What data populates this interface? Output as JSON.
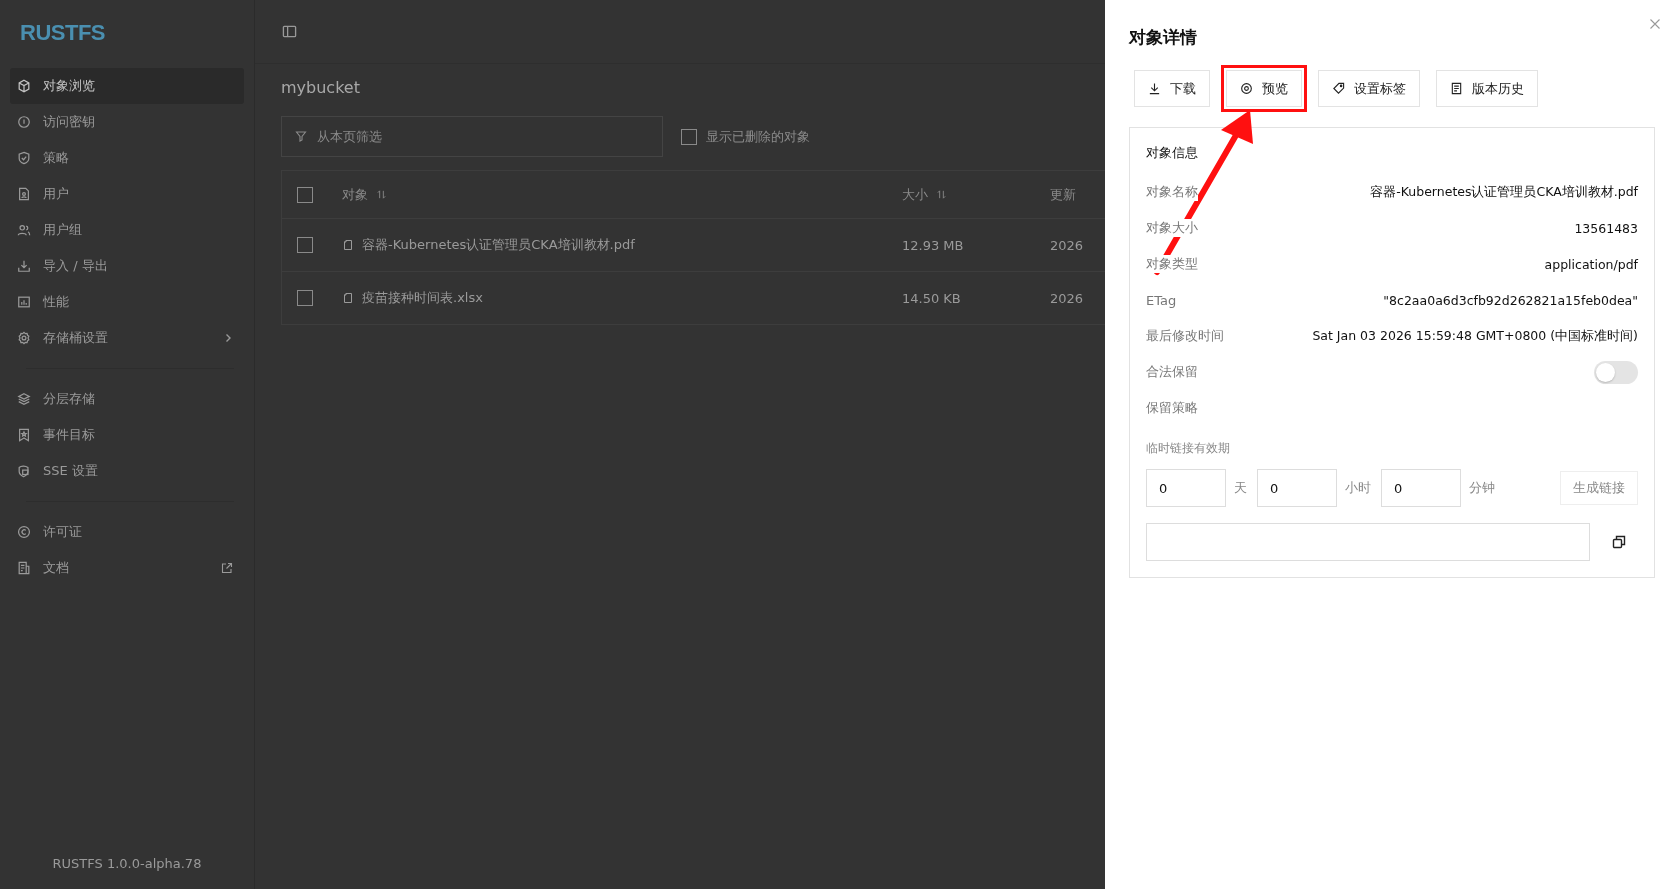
{
  "sidebar": {
    "logo": "RUSTFS",
    "groups": [
      [
        {
          "label": "对象浏览",
          "selected": true,
          "kind": "plain"
        },
        {
          "label": "访问密钥",
          "selected": false,
          "kind": "plain"
        },
        {
          "label": "策略",
          "selected": false,
          "kind": "plain"
        },
        {
          "label": "用户",
          "selected": false,
          "kind": "plain"
        },
        {
          "label": "用户组",
          "selected": false,
          "kind": "plain"
        },
        {
          "label": "导入 / 导出",
          "selected": false,
          "kind": "plain"
        },
        {
          "label": "性能",
          "selected": false,
          "kind": "plain"
        },
        {
          "label": "存储桶设置",
          "selected": false,
          "kind": "submenu"
        }
      ],
      [
        {
          "label": "分层存储",
          "selected": false,
          "kind": "plain"
        },
        {
          "label": "事件目标",
          "selected": false,
          "kind": "plain"
        },
        {
          "label": "SSE 设置",
          "selected": false,
          "kind": "plain"
        }
      ],
      [
        {
          "label": "许可证",
          "selected": false,
          "kind": "plain"
        },
        {
          "label": "文档",
          "selected": false,
          "kind": "external"
        }
      ]
    ],
    "version": "RUSTFS 1.0.0-alpha.78"
  },
  "bucket": "mybucket",
  "filter": {
    "placeholder": "从本页筛选"
  },
  "show_deleted": {
    "label": "显示已删除的对象",
    "checked": false
  },
  "table": {
    "select_all": {
      "checked": false
    },
    "columns": [
      {
        "label": "对象",
        "sortable": true
      },
      {
        "label": "大小",
        "sortable": true
      },
      {
        "label": "更新",
        "sortable": false
      }
    ],
    "rows": [
      {
        "name": "容器-Kubernetes认证管理员CKA培训教材.pdf",
        "size": "12.93 MB",
        "column_3": "2026",
        "checked": false
      },
      {
        "name": "疫苗接种时间表.xlsx",
        "size": "14.50 KB",
        "column_3": "2026",
        "checked": false
      }
    ]
  },
  "drawer": {
    "title": "对象详情",
    "actions": [
      {
        "label": "下载",
        "highlighted": false
      },
      {
        "label": "预览",
        "highlighted": true
      },
      {
        "label": "设置标签",
        "highlighted": false
      },
      {
        "label": "版本历史",
        "highlighted": false
      }
    ],
    "annotation_arrow": true,
    "info_title": "对象信息",
    "fields": [
      {
        "label": "对象名称",
        "value": "容器-Kubernetes认证管理员CKA培训教材.pdf"
      },
      {
        "label": "对象大小",
        "value": "13561483"
      },
      {
        "label": "对象类型",
        "value": "application/pdf"
      },
      {
        "label": "ETag",
        "value": "\"8c2aa0a6d3cfb92d262821a15feb0dea\""
      },
      {
        "label": "最后修改时间",
        "value": "Sat Jan 03 2026 15:59:48 GMT+0800 (中国标准时间)"
      }
    ],
    "legal_hold": {
      "label": "合法保留",
      "on": false
    },
    "retention_label": "保留策略",
    "expiry": {
      "label": "临时链接有效期",
      "parts": [
        {
          "value": "0",
          "unit": "天"
        },
        {
          "value": "0",
          "unit": "小时"
        },
        {
          "value": "0",
          "unit": "分钟"
        }
      ],
      "generate": "生成链接"
    }
  }
}
